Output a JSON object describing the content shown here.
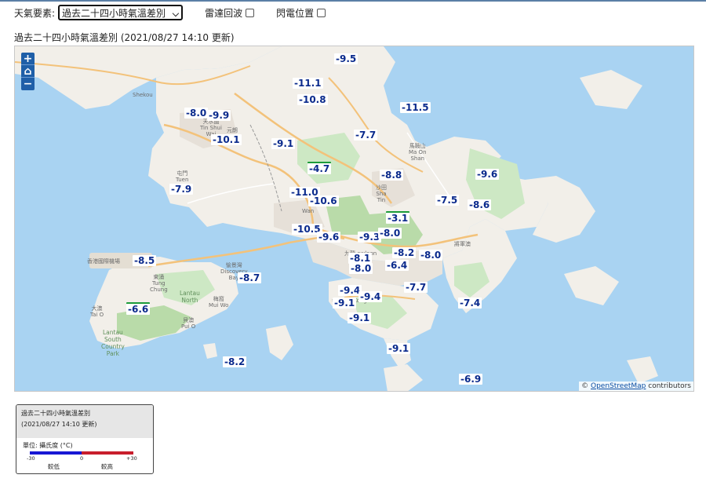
{
  "toolbar": {
    "element_label": "天氣要素:",
    "selected_option": "過去二十四小時氣溫差別",
    "radar_label": "雷達回波",
    "lightning_label": "閃電位置"
  },
  "subtitle": "過去二十四小時氣溫差別 (2021/08/27 14:10 更新)",
  "map": {
    "attribution_prefix": "©",
    "attribution_link": "OpenStreetMap",
    "attribution_suffix": "contributors",
    "places": [
      {
        "id": "shekou",
        "text": "Shekou"
      },
      {
        "id": "tinshuiwai",
        "text": "天水圍\nTin Shui\nWai"
      },
      {
        "id": "yuenlong",
        "text": "元朗"
      },
      {
        "id": "tuen",
        "text": "屯門\nTuen"
      },
      {
        "id": "maonshan",
        "text": "馬鞍山\nMa On\nShan"
      },
      {
        "id": "shatin",
        "text": "沙田\nSha\nTin"
      },
      {
        "id": "wan",
        "text": "Wan"
      },
      {
        "id": "kowloon",
        "text": "九龍 owloon"
      },
      {
        "id": "hongkong",
        "text": "香港 ng Kong"
      },
      {
        "id": "discovery",
        "text": "愉景灣\nDiscovery\nBay"
      },
      {
        "id": "tungchung",
        "text": "東涌\nTung\nChung"
      },
      {
        "id": "lantaunorth",
        "text": "Lantau\nNorth"
      },
      {
        "id": "muiwo",
        "text": "梅窩\nMui Wo"
      },
      {
        "id": "taio",
        "text": "大澳\nTai O"
      },
      {
        "id": "puio",
        "text": "貝澳\nPui O"
      },
      {
        "id": "lantausouth",
        "text": "Lantau\nSouth\nCountry\nPark"
      },
      {
        "id": "tseungkwano",
        "text": "將軍澳"
      },
      {
        "id": "airport",
        "text": "香港國際機場"
      }
    ]
  },
  "stations": [
    {
      "id": "s01",
      "value": "-9.5",
      "warm": false
    },
    {
      "id": "s02",
      "value": "-11.1",
      "warm": false
    },
    {
      "id": "s03",
      "value": "-10.8",
      "warm": false
    },
    {
      "id": "s04",
      "value": "-11.5",
      "warm": false
    },
    {
      "id": "s05",
      "value": "-8.0",
      "warm": false
    },
    {
      "id": "s06",
      "value": "-9.9",
      "warm": false
    },
    {
      "id": "s07",
      "value": "-10.1",
      "warm": false
    },
    {
      "id": "s08",
      "value": "-9.1",
      "warm": false
    },
    {
      "id": "s09",
      "value": "-7.7",
      "warm": false
    },
    {
      "id": "s10",
      "value": "-4.7",
      "warm": true
    },
    {
      "id": "s11",
      "value": "-8.8",
      "warm": false
    },
    {
      "id": "s12",
      "value": "-9.6",
      "warm": false
    },
    {
      "id": "s13",
      "value": "-7.9",
      "warm": false
    },
    {
      "id": "s14",
      "value": "-11.0",
      "warm": false
    },
    {
      "id": "s15",
      "value": "-10.6",
      "warm": false
    },
    {
      "id": "s16",
      "value": "-7.5",
      "warm": false
    },
    {
      "id": "s17",
      "value": "-8.6",
      "warm": false
    },
    {
      "id": "s18",
      "value": "-3.1",
      "warm": true
    },
    {
      "id": "s19",
      "value": "-10.5",
      "warm": false
    },
    {
      "id": "s20",
      "value": "-9.6",
      "warm": false
    },
    {
      "id": "s21",
      "value": "-9.3",
      "warm": false
    },
    {
      "id": "s22",
      "value": "-8.0",
      "warm": false
    },
    {
      "id": "s23",
      "value": "-8.5",
      "warm": false
    },
    {
      "id": "s24",
      "value": "-8.1",
      "warm": false
    },
    {
      "id": "s25",
      "value": "-8.0",
      "warm": false
    },
    {
      "id": "s26",
      "value": "-8.2",
      "warm": false
    },
    {
      "id": "s27",
      "value": "-8.0",
      "warm": false
    },
    {
      "id": "s28",
      "value": "-6.4",
      "warm": false
    },
    {
      "id": "s29",
      "value": "-8.7",
      "warm": false
    },
    {
      "id": "s30",
      "value": "-9.4",
      "warm": false
    },
    {
      "id": "s31",
      "value": "-9.1",
      "warm": false
    },
    {
      "id": "s32",
      "value": "-9.4",
      "warm": false
    },
    {
      "id": "s33",
      "value": "-7.7",
      "warm": false
    },
    {
      "id": "s34",
      "value": "-6.6",
      "warm": true
    },
    {
      "id": "s35",
      "value": "-7.4",
      "warm": false
    },
    {
      "id": "s36",
      "value": "-9.1",
      "warm": false
    },
    {
      "id": "s37",
      "value": "-9.1",
      "warm": false
    },
    {
      "id": "s38",
      "value": "-8.2",
      "warm": false
    },
    {
      "id": "s39",
      "value": "-6.9",
      "warm": false
    }
  ],
  "legend": {
    "title": "過去二十四小時氣溫差別",
    "updated": "(2021/08/27 14:10 更新)",
    "unit": "單位: 攝氏度 (°C)",
    "tick_min": "-30",
    "tick_mid": "0",
    "tick_max": "+30",
    "cold_label": "較低",
    "warm_label": "較高",
    "cold_color": "#1717d4",
    "warm_color": "#c81e2c"
  }
}
